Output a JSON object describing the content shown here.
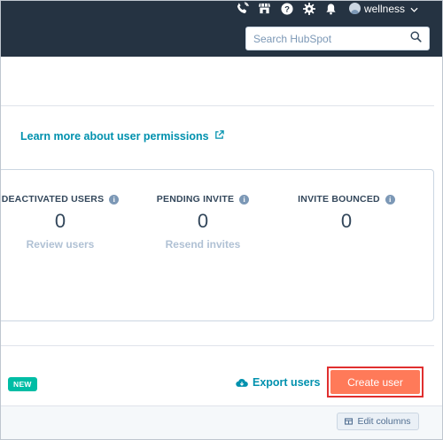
{
  "topnav": {
    "icons": [
      "phone-icon",
      "marketplace-icon",
      "help-icon",
      "settings-icon",
      "notifications-icon"
    ],
    "account_name": "wellness"
  },
  "search": {
    "placeholder": "Search HubSpot"
  },
  "learn_more": {
    "label": "Learn more about user permissions"
  },
  "stats": [
    {
      "label": "DEACTIVATED USERS",
      "value": "0",
      "link": "Review users"
    },
    {
      "label": "PENDING INVITE",
      "value": "0",
      "link": "Resend invites"
    },
    {
      "label": "INVITE BOUNCED",
      "value": "0"
    }
  ],
  "actions": {
    "new_badge": "NEW",
    "export_label": "Export users",
    "create_label": "Create user"
  },
  "table": {
    "edit_columns_label": "Edit columns"
  },
  "colors": {
    "nav_bg": "#253342",
    "link": "#0091ae",
    "primary": "#ff7a59",
    "badge": "#00bda5",
    "highlight_border": "#e02f2f"
  }
}
